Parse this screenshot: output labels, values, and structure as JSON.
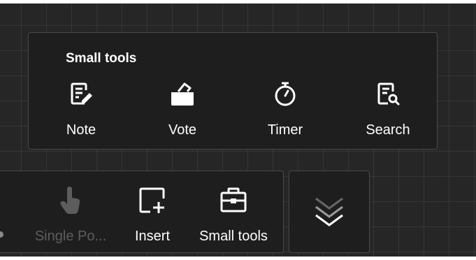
{
  "popup": {
    "title": "Small tools",
    "tools": [
      {
        "label": "Note",
        "icon": "note-icon"
      },
      {
        "label": "Vote",
        "icon": "vote-icon"
      },
      {
        "label": "Timer",
        "icon": "timer-icon"
      },
      {
        "label": "Search",
        "icon": "search-icon"
      }
    ]
  },
  "toolbar": {
    "items": [
      {
        "label": "Single Po...",
        "icon": "single-pointer-icon",
        "disabled": true
      },
      {
        "label": "Insert",
        "icon": "insert-icon"
      },
      {
        "label": "Small tools",
        "icon": "toolbox-icon"
      }
    ],
    "collapse_icon": "chevrons-down-icon"
  },
  "colors": {
    "background": "#262626",
    "panel": "#1e1e1e",
    "border": "#4a4a4a",
    "text": "#ffffff",
    "disabled_text": "#5d5d5d"
  }
}
